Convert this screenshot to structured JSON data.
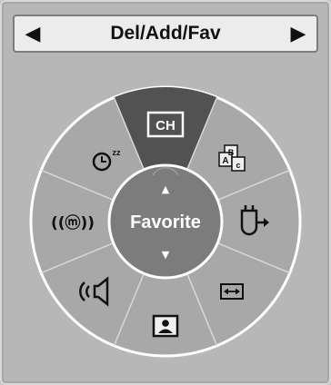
{
  "header": {
    "title": "Del/Add/Fav",
    "prev_arrow": "◀",
    "next_arrow": "▶"
  },
  "center": {
    "label": "Favorite",
    "up_arrow": "▲",
    "down_arrow": "▼"
  },
  "menu": {
    "ch_label": "CH",
    "selected": "CH",
    "items": [
      {
        "icon": "ch-icon"
      },
      {
        "icon": "aspect-swap-icon"
      },
      {
        "icon": "input-exit-icon"
      },
      {
        "icon": "resize-icon"
      },
      {
        "icon": "picture-icon"
      },
      {
        "icon": "speaker-icon"
      },
      {
        "icon": "signal-m-icon"
      },
      {
        "icon": "sleep-timer-icon"
      }
    ],
    "signal_label": "((ⓜ))",
    "sleep_z": "zz",
    "swap_a": "A",
    "swap_b": "B",
    "swap_c": "c"
  },
  "colors": {
    "wheel": "#a8a8a8",
    "wheel_border": "#ffffff",
    "selected_segment": "#525252",
    "center": "#7c7c7c",
    "header_bg": "#ececec"
  }
}
